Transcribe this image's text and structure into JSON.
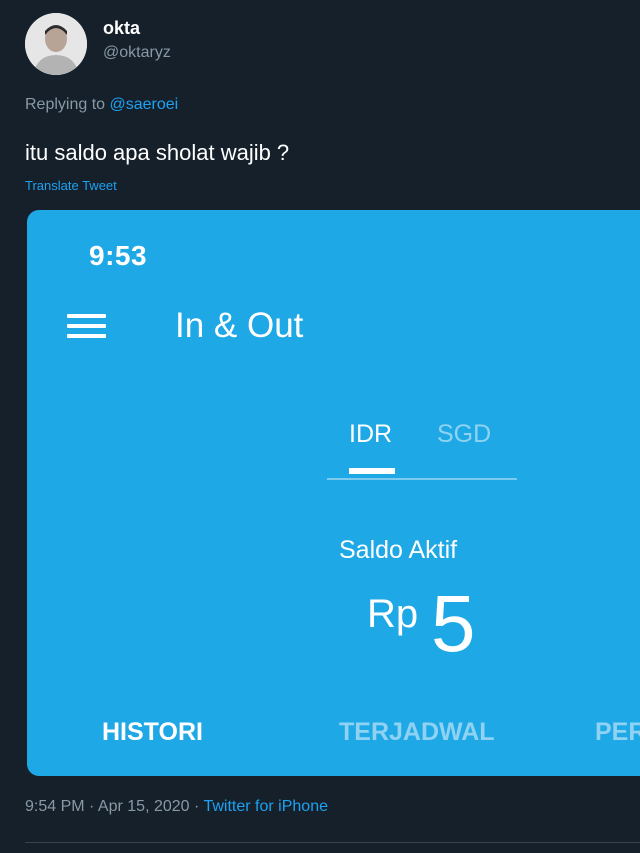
{
  "tweet": {
    "display_name": "okta",
    "handle": "@oktaryz",
    "replying_prefix": "Replying to",
    "replying_to": "@saeroei",
    "text": "itu saldo apa sholat wajib ?",
    "translate_label": "Translate Tweet",
    "timestamp": "9:54 PM · Apr 15, 2020",
    "separator": " · ",
    "source": "Twitter for iPhone"
  },
  "app_screenshot": {
    "status_time": "9:53",
    "title": "In & Out",
    "menu_icon": "hamburger-menu-icon",
    "currency_tabs": [
      {
        "label": "IDR",
        "active": true
      },
      {
        "label": "SGD",
        "active": false
      }
    ],
    "balance_label": "Saldo Aktif",
    "currency_prefix": "Rp",
    "balance_value": "5",
    "bottom_tabs": [
      {
        "label": "HISTORI",
        "active": true
      },
      {
        "label": "TERJADWAL",
        "active": false
      },
      {
        "label": "PER",
        "active": false
      }
    ]
  },
  "colors": {
    "background": "#15202b",
    "app_blue": "#1fa8e6",
    "link": "#1da1f2",
    "secondary_text": "#8899a6"
  }
}
